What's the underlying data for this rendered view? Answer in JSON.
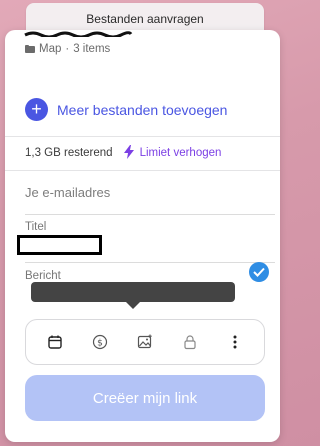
{
  "tab_title": "Bestanden aanvragen",
  "meta": {
    "type": "Map",
    "separator": "·",
    "count": "3 items"
  },
  "add_files_label": "Meer bestanden toevoegen",
  "storage": {
    "remaining": "1,3 GB resterend",
    "upgrade_label": "Limiet verhogen"
  },
  "email": {
    "placeholder": "Je e-mailadres",
    "value": ""
  },
  "title_label": "Titel",
  "message_label": "Bericht",
  "toolbar": {
    "icons": [
      "calendar-icon",
      "dollar-icon",
      "image-icon",
      "lock-icon",
      "more-icon"
    ]
  },
  "cta_label": "Creëer mijn link",
  "colors": {
    "accent": "#4a56e2",
    "purple": "#7b3fe4",
    "cta_disabled": "#b3c3f6",
    "check": "#2f8de4"
  }
}
